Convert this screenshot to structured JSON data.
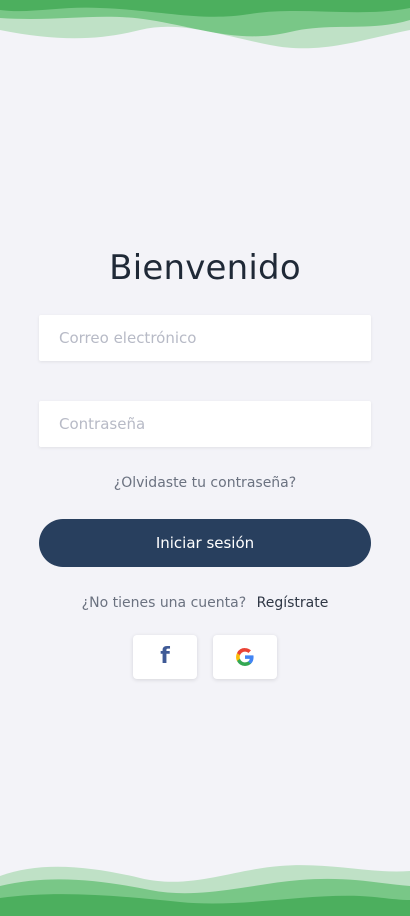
{
  "screen": {
    "title": "Bienvenido"
  },
  "form": {
    "email_placeholder": "Correo electrónico",
    "email_value": "",
    "password_placeholder": "Contraseña",
    "password_value": "",
    "forgot_label": "¿Olvidaste tu contraseña?",
    "login_label": "Iniciar sesión"
  },
  "register": {
    "question": "¿No tienes una cuenta?",
    "link_label": "Regístrate"
  },
  "social": {
    "facebook_icon": "facebook-icon",
    "google_icon": "google-icon",
    "facebook_glyph": "f"
  },
  "colors": {
    "background": "#f3f3f8",
    "primary_button": "#283f5e",
    "wave_green": "#4caf5e",
    "title_text": "#1f2937"
  }
}
